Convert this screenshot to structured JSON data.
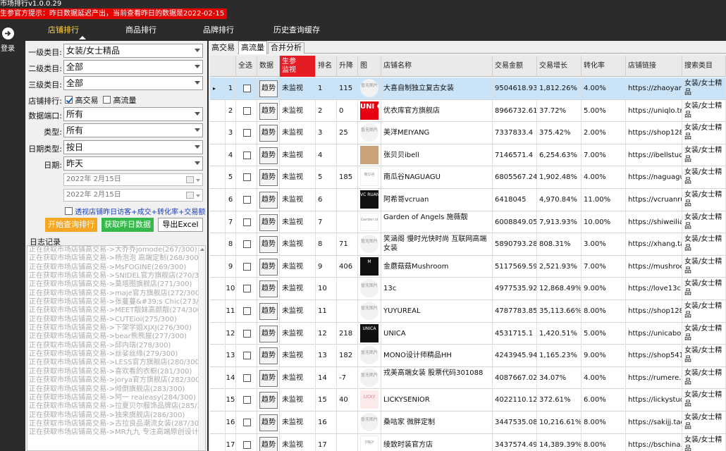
{
  "app": {
    "title": "市场排行v1.0.0.29",
    "notice": "生参官方提示：昨日数据延迟产出，当前查看昨日的数据是2022-02-15",
    "login_label": "登录"
  },
  "nav": {
    "tabs": [
      {
        "label": "店铺排行",
        "active": true
      },
      {
        "label": "商品排行",
        "active": false
      },
      {
        "label": "品牌排行",
        "active": false
      },
      {
        "label": "历史查询缓存",
        "active": false
      }
    ]
  },
  "filters": {
    "cat1_label": "一级类目:",
    "cat1_value": "女装/女士精品",
    "cat2_label": "二级类目:",
    "cat2_value": "全部",
    "cat3_label": "三级类目:",
    "cat3_value": "全部",
    "rank_label": "店铺排行:",
    "rank_opt1": "高交易",
    "rank_opt2": "高流量",
    "port_label": "数据端口:",
    "port_value": "所有",
    "type_label": "类型:",
    "type_value": "所有",
    "datetype_label": "日期类型:",
    "datetype_value": "按日",
    "date_label": "日期:",
    "date_value": "昨天",
    "date_from": "2022年  2月15日",
    "date_to": "2022年  2月15日",
    "extra_checkbox": "透视店铺昨日访客+成交+转化率+交易额"
  },
  "buttons": {
    "start": "开始查询排行",
    "fetch": "获取昨日数据",
    "export": "导出Excel"
  },
  "log": {
    "label": "日志记录",
    "lines": [
      "正在获取市场店铺高交易->大乔乔jomode(267/300)",
      "正在获取市场店铺高交易->杨泡泡 高端定制(268/300)",
      "正在获取市场店铺高交易->MsFOGINE(269/300)",
      "正在获取市场店铺高交易->SNIDEL官方旗舰店(270/300)",
      "正在获取市场店铺高交易->莫塔图旗舰店(271/300)",
      "正在获取市场店铺高交易->maje官方旗舰店(272/300)",
      "正在获取市场店铺高交易->张蔓蔓&#39;s   Chic(273/300)",
      "正在获取市场店铺高交易->MEET靓妹高颜靓(274/300)",
      "正在获取市场店铺高交易->CUTEioi(275/300)",
      "正在获取市场店铺高交易->下架学姐XJXJ(276/300)",
      "正在获取市场店铺高交易->bear熊熊屋(277/300)",
      "正在获取市场店铺高交易->邱内瑞(278/300)",
      "正在获取市场店铺高交易->丝娑丝缘(279/300)",
      "正在获取市场店铺高交易->LESS官方旗舰店(280/300)",
      "正在获取市场店铺高交易->喜欢看的衣橱(281/300)",
      "正在获取市场店铺高交易->jorya官方旗舰店(282/300)",
      "正在获取市场店铺高交易->倾倒旗舰店(283/300)",
      "正在获取市场店铺高交易->阿一 realeasy(284/300)",
      "正在获取市场店铺高交易->拉夏贝尔服饰品牌店(285/300)",
      "正在获取市场店铺高交易->独来旗舰店(286/300)",
      "正在获取市场店铺高交易->古拉良品潮流女装(287/300)",
      "正在获取市场店铺高交易->MR九九 专注高端原创设计(288/300)"
    ]
  },
  "subtabs": [
    "高交易",
    "高流量",
    "合并分析"
  ],
  "table": {
    "headers": {
      "select": "全选",
      "data": "数据",
      "monitor": "生参\n监视",
      "rank": "排名",
      "change": "升降",
      "image": "图",
      "shop": "店铺名称",
      "amount": "交易金额",
      "growth": "交易增长",
      "conversion": "转化率",
      "link": "店铺链接",
      "category": "搜索类目"
    },
    "trend_label": "趋势",
    "rows": [
      {
        "idx": "1",
        "mon": "未监视",
        "rank": "1",
        "chg": "115",
        "logo": "circle",
        "logo_text": "暂无图片",
        "shop": "大喜自制独立复古女装",
        "amt": "9504618.93",
        "grow": "1,812.26%",
        "conv": "4.00%",
        "link": "https://zhaoyanqiu",
        "cat": "女装/女士精品"
      },
      {
        "idx": "2",
        "mon": "未监视",
        "rank": "2",
        "chg": "0",
        "logo": "uni",
        "logo_text": "UNI QLO",
        "shop": "优衣库官方旗舰店",
        "amt": "8966732.61",
        "grow": "37.72%",
        "conv": "5.00%",
        "link": "https://uniqlo.tmall",
        "cat": "女装/女士精品"
      },
      {
        "idx": "3",
        "mon": "未监视",
        "rank": "3",
        "chg": "25",
        "logo": "circle",
        "logo_text": "暂无图片",
        "shop": "美洋MEIYANG",
        "amt": "7337833.4",
        "grow": "375.42%",
        "conv": "2.00%",
        "link": "https://shop1285",
        "cat": "女装/女士精品"
      },
      {
        "idx": "4",
        "mon": "未监视",
        "rank": "4",
        "chg": "",
        "logo": "photo",
        "logo_text": "",
        "shop": "张贝贝ibell",
        "amt": "7146571.4",
        "grow": "6,254.63%",
        "conv": "7.00%",
        "link": "https://ibellstudio",
        "cat": "女装/女士精品"
      },
      {
        "idx": "5",
        "mon": "未监视",
        "rank": "5",
        "chg": "185",
        "logo": "white",
        "logo_text": "南瓜谷",
        "shop": "南瓜谷NAGUAGU",
        "amt": "6805567.24",
        "grow": "1,902.48%",
        "conv": "4.00%",
        "link": "https://naguagu.t",
        "cat": "女装/女士精品"
      },
      {
        "idx": "6",
        "mon": "未监视",
        "rank": "6",
        "chg": "",
        "logo": "black",
        "logo_text": "VC RUAN STU DIO",
        "shop": "阿希哥vcruan",
        "amt": "6418045",
        "grow": "4,970.84%",
        "conv": "11.00%",
        "link": "https://vcruanrua",
        "cat": "女装/女士精品"
      },
      {
        "idx": "7",
        "mon": "未监视",
        "rank": "7",
        "chg": "",
        "logo": "white",
        "logo_text": "Garden of Angels",
        "shop": "Garden of Angels 施薇靓",
        "amt": "6008849.05",
        "grow": "7,913.93%",
        "conv": "10.00%",
        "link": "https://shiweilian",
        "cat": "女装/女士精品"
      },
      {
        "idx": "8",
        "mon": "未监视",
        "rank": "8",
        "chg": "71",
        "logo": "circle",
        "logo_text": "暂无图片",
        "shop": "笑涵阁 慢时光快时尚 互联网高端女装",
        "amt": "5890793.28",
        "grow": "808.31%",
        "conv": "3.00%",
        "link": "https://xhang.tao",
        "cat": "女装/女士精品"
      },
      {
        "idx": "9",
        "mon": "未监视",
        "rank": "9",
        "chg": "406",
        "logo": "black",
        "logo_text": "M",
        "shop": "金蘑菇菇Mushroom",
        "amt": "5117569.59",
        "grow": "2,521.93%",
        "conv": "7.00%",
        "link": "https://mushroom",
        "cat": "女装/女士精品"
      },
      {
        "idx": "10",
        "mon": "未监视",
        "rank": "10",
        "chg": "",
        "logo": "circle",
        "logo_text": "暂无图片",
        "shop": "13c",
        "amt": "4977535.92",
        "grow": "12,868.49%",
        "conv": "9.00%",
        "link": "https://love13c.ta",
        "cat": "女装/女士精品"
      },
      {
        "idx": "11",
        "mon": "未监视",
        "rank": "11",
        "chg": "",
        "logo": "circle",
        "logo_text": "暂无图片",
        "shop": "YUYUREAL",
        "amt": "4787783.85",
        "grow": "35,113.66%",
        "conv": "8.00%",
        "link": "https://shop1286",
        "cat": "女装/女士精品"
      },
      {
        "idx": "12",
        "mon": "未监视",
        "rank": "12",
        "chg": "218",
        "logo": "black",
        "logo_text": "UNICA",
        "shop": "UNICA",
        "amt": "4531715.1",
        "grow": "1,420.51%",
        "conv": "5.00%",
        "link": "https://unicabout",
        "cat": "女装/女士精品"
      },
      {
        "idx": "13",
        "mon": "未监视",
        "rank": "13",
        "chg": "182",
        "logo": "circle",
        "logo_text": "暂无图片",
        "shop": "MONO设计师精品HH",
        "amt": "4243945.94",
        "grow": "1,165.23%",
        "conv": "9.00%",
        "link": "https://shop5411",
        "cat": "女装/女士精品"
      },
      {
        "idx": "14",
        "mon": "未监视",
        "rank": "14",
        "chg": "-7",
        "logo": "circle",
        "logo_text": "暂无图片",
        "shop": "戎美高端女装 股票代码301088",
        "amt": "4087667.02",
        "grow": "34.07%",
        "conv": "4.00%",
        "link": "https://rumere.tm",
        "cat": "女装/女士精品"
      },
      {
        "idx": "15",
        "mon": "未监视",
        "rank": "15",
        "chg": "40",
        "logo": "pink",
        "logo_text": "LICKY",
        "shop": "LICKYSENIOR",
        "amt": "4022110.12",
        "grow": "372.61%",
        "conv": "6.00%",
        "link": "https://lickystudi",
        "cat": "女装/女士精品"
      },
      {
        "idx": "16",
        "mon": "未监视",
        "rank": "16",
        "chg": "",
        "logo": "circle",
        "logo_text": "暂无图片",
        "shop": "桑咕家 微胖定制",
        "amt": "3447535.08",
        "grow": "10,216.61%",
        "conv": "8.00%",
        "link": "https://sakijj.tao",
        "cat": "女装/女士精品"
      },
      {
        "idx": "17",
        "mon": "未监视",
        "rank": "17",
        "chg": "",
        "logo": "white",
        "logo_text": "ONLY",
        "shop": "绫致时装官方店",
        "amt": "3437574.49",
        "grow": "14,389.39%",
        "conv": "8.00%",
        "link": "https://bschina.t",
        "cat": "女装/女士精品"
      }
    ]
  },
  "colors": {
    "accent_tab": "#ffd24a",
    "notice_bg": "#e60000",
    "monitor_header": "#e61c24",
    "btn_orange": "#f5a623",
    "btn_green": "#35b84a",
    "selected_row": "#cbe3f7"
  }
}
